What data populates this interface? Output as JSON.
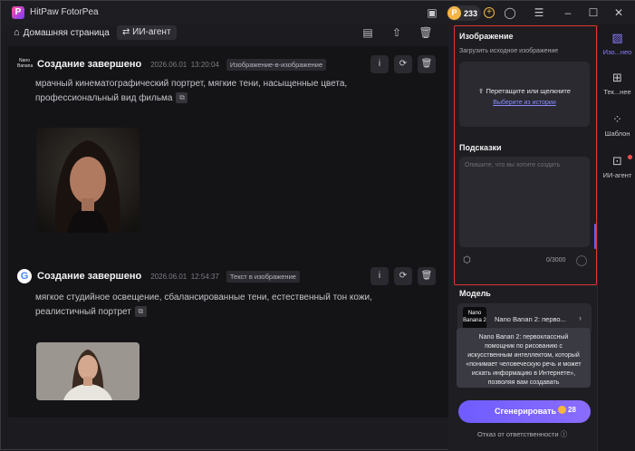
{
  "app": {
    "title": "HitPaw FotorPea",
    "credits": "233"
  },
  "toolbar": {
    "home_label": "Домашняя страница",
    "agent_label": "ИИ-агент"
  },
  "cards": [
    {
      "title": "Создание завершено",
      "date": "2026.06.01",
      "time": "13:20:04",
      "tag": "Изображение-в-изображение",
      "model_badge": "Nano Banana",
      "prompt": "мрачный кинематографический портрет, мягкие тени, насыщенные цвета, профессиональный вид фильма"
    },
    {
      "title": "Создание завершено",
      "date": "2026.06.01",
      "time": "12:54:37",
      "tag": "Текст в изображение",
      "model_badge": "G",
      "prompt": "мягкое студийное освещение, сбалансированные тени, естественный тон кожи, реалистичный портрет"
    }
  ],
  "panel": {
    "image_title": "Изображение",
    "image_sub": "Загрузить исходное изображение",
    "upload_main": "Перетащите или щелкните",
    "upload_link": "Выберите из истории",
    "hints_title": "Подсказки",
    "hints_placeholder": "Опишите, что вы хотите создать",
    "counter": "0/3000",
    "model_title": "Модель",
    "model_thumb": "Nano Banana 2",
    "model_name": "Nano Banan 2: перво...",
    "tooltip": "Nano Banan 2: первоклассный помощник по рисованию с искусственным интеллектом, который «понимает человеческую речь и может искать информацию в Интернете», позволяя вам создавать",
    "generate_label": "Сгенерировать",
    "generate_cost": "28",
    "disclaimer": "Отказ от ответственности"
  },
  "sidebar": [
    {
      "label": "Изо...нео",
      "icon": "image-icon",
      "active": true
    },
    {
      "label": "Тек...нее",
      "icon": "text-icon",
      "active": false
    },
    {
      "label": "Шаблон",
      "icon": "template-icon",
      "active": false
    },
    {
      "label": "ИИ-агент",
      "icon": "agent-icon",
      "active": false
    }
  ],
  "colors": {
    "accent": "#7b6cff",
    "coin": "#f5b640",
    "highlight": "#e03434"
  }
}
